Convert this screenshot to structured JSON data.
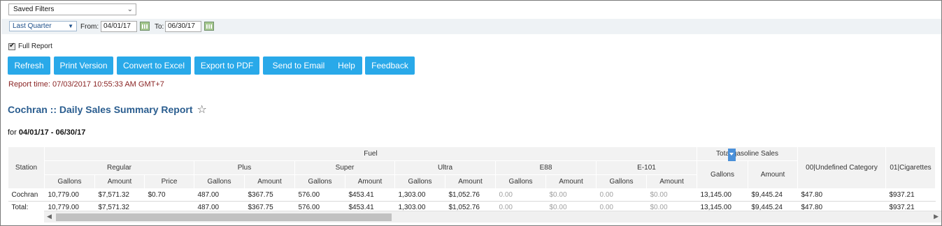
{
  "filters": {
    "saved_filters": "Saved Filters",
    "period": "Last Quarter",
    "from_label": "From:",
    "from_value": "04/01/17",
    "to_label": "To:",
    "to_value": "06/30/17",
    "full_report_label": "Full Report",
    "full_report_checked": true
  },
  "toolbar": {
    "refresh": "Refresh",
    "print": "Print Version",
    "excel": "Convert to Excel",
    "pdf": "Export to PDF",
    "email": "Send to Email",
    "help": "Help",
    "feedback": "Feedback"
  },
  "report": {
    "time": "Report time: 07/03/2017 10:55:33 AM GMT+7",
    "title": "Cochran :: Daily Sales Summary Report",
    "for_prefix": "for",
    "for_range": "04/01/17 - 06/30/17"
  },
  "table": {
    "station_header": "Station",
    "fuel_header": "Fuel",
    "total_gas_header": "Total gasoline Sales",
    "products": {
      "regular": "Regular",
      "plus": "Plus",
      "super": "Super",
      "ultra": "Ultra",
      "e88": "E88",
      "e101": "E-101"
    },
    "cols": {
      "gallons": "Gallons",
      "amount": "Amount",
      "price": "Price"
    },
    "cat_undefined": "00|Undefined Category",
    "cat_cigarettes": "01|Cigarettes",
    "rows": [
      {
        "station": "Cochran",
        "reg_gal": "10,779.00",
        "reg_amt": "$7,571.32",
        "reg_price": "$0.70",
        "plus_gal": "487.00",
        "plus_amt": "$367.75",
        "super_gal": "576.00",
        "super_amt": "$453.41",
        "ultra_gal": "1,303.00",
        "ultra_amt": "$1,052.76",
        "e88_gal": "0.00",
        "e88_amt": "$0.00",
        "e101_gal": "0.00",
        "e101_amt": "$0.00",
        "tot_gal": "13,145.00",
        "tot_amt": "$9,445.24",
        "cat_undefined": "$47.80",
        "cat_cigarettes": "$937.21"
      },
      {
        "station": "Total:",
        "reg_gal": "10,779.00",
        "reg_amt": "$7,571.32",
        "reg_price": "",
        "plus_gal": "487.00",
        "plus_amt": "$367.75",
        "super_gal": "576.00",
        "super_amt": "$453.41",
        "ultra_gal": "1,303.00",
        "ultra_amt": "$1,052.76",
        "e88_gal": "0.00",
        "e88_amt": "$0.00",
        "e101_gal": "0.00",
        "e101_amt": "$0.00",
        "tot_gal": "13,145.00",
        "tot_amt": "$9,445.24",
        "cat_undefined": "$47.80",
        "cat_cigarettes": "$937.21"
      }
    ]
  },
  "colors": {
    "button": "#29a9e9",
    "title": "#2a5d8f",
    "report_time": "#8a2424"
  }
}
